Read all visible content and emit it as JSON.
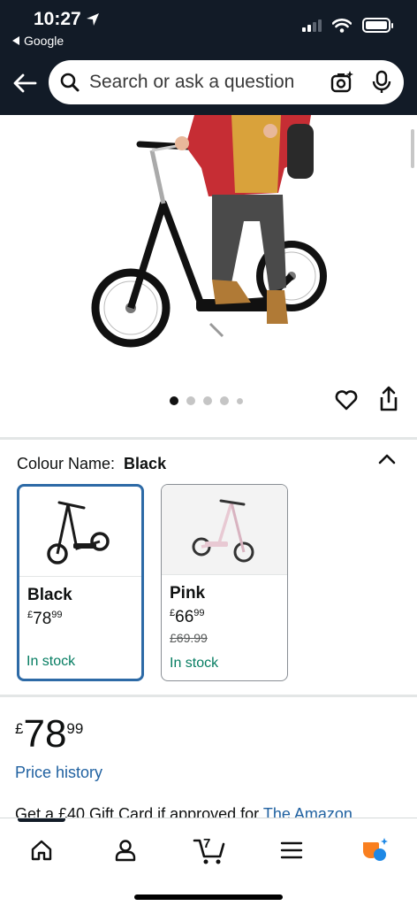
{
  "status": {
    "time": "10:27",
    "back_app": "Google"
  },
  "search": {
    "placeholder": "Search or ask a question"
  },
  "gallery": {
    "image_count": 5,
    "active_index": 0
  },
  "colour": {
    "label": "Colour Name:",
    "selected": "Black",
    "options": [
      {
        "name": "Black",
        "currency": "£",
        "whole": "78",
        "fraction": "99",
        "was": "",
        "stock": "In stock",
        "frame_color": "#1a1a1a"
      },
      {
        "name": "Pink",
        "currency": "£",
        "whole": "66",
        "fraction": "99",
        "was": "£69.99",
        "stock": "In stock",
        "frame_color": "#e8c9d3"
      }
    ]
  },
  "price": {
    "currency": "£",
    "whole": "78",
    "fraction": "99",
    "history_link": "Price history"
  },
  "promo": {
    "text": "Get a £40 Gift Card if approved for ",
    "link": "The Amazon"
  },
  "nav": {
    "items": [
      "home",
      "account",
      "cart",
      "menu",
      "assistant"
    ],
    "cart_count": "7",
    "accent_color": "#f97f1f"
  },
  "colors": {
    "header_bg": "#121b27",
    "link": "#2162a1",
    "stock": "#067d62",
    "selected_border": "#2d6aa6"
  }
}
